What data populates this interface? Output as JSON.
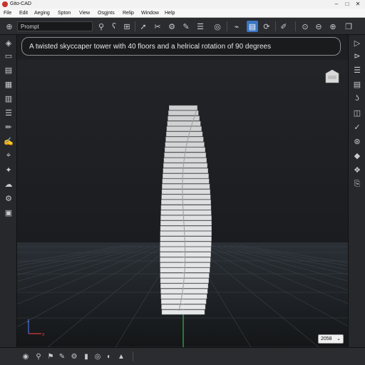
{
  "app": {
    "title": "Gito-CAD"
  },
  "window_controls": {
    "minimize": "–",
    "maximize": "□",
    "close": "✕"
  },
  "menu": [
    "File",
    "Edit",
    "Aeging",
    "Spton",
    "View",
    "Osgjnts",
    "Relip",
    "Window",
    "Help"
  ],
  "toolbar": {
    "prompt_placeholder": "Prompt",
    "icons": [
      "search-icon",
      "curve-icon",
      "column-icon",
      "cursor-icon",
      "settings-icon",
      "pen-icon",
      "list-icon",
      "target-icon",
      "document-icon",
      "rotate-icon",
      "edit-icon",
      "zoom-icon",
      "minus-icon",
      "plus-icon",
      "layers-icon"
    ]
  },
  "prompt_banner": {
    "text": "A twisted skyccaper tower with 40 floors and a helrical rotation of 90 degrees"
  },
  "model": {
    "floors": 40,
    "rotation_degrees": 90
  },
  "axes": {
    "x": "x",
    "z": "z"
  },
  "zoom": {
    "value": "2058"
  },
  "colors": {
    "accent": "#3a75c4",
    "viewport_bg": "#1e2023",
    "tower": "#e4e5e6",
    "axis_x": "#d23b3b",
    "axis_y": "#3bb34a",
    "axis_z": "#4a6fd8"
  }
}
